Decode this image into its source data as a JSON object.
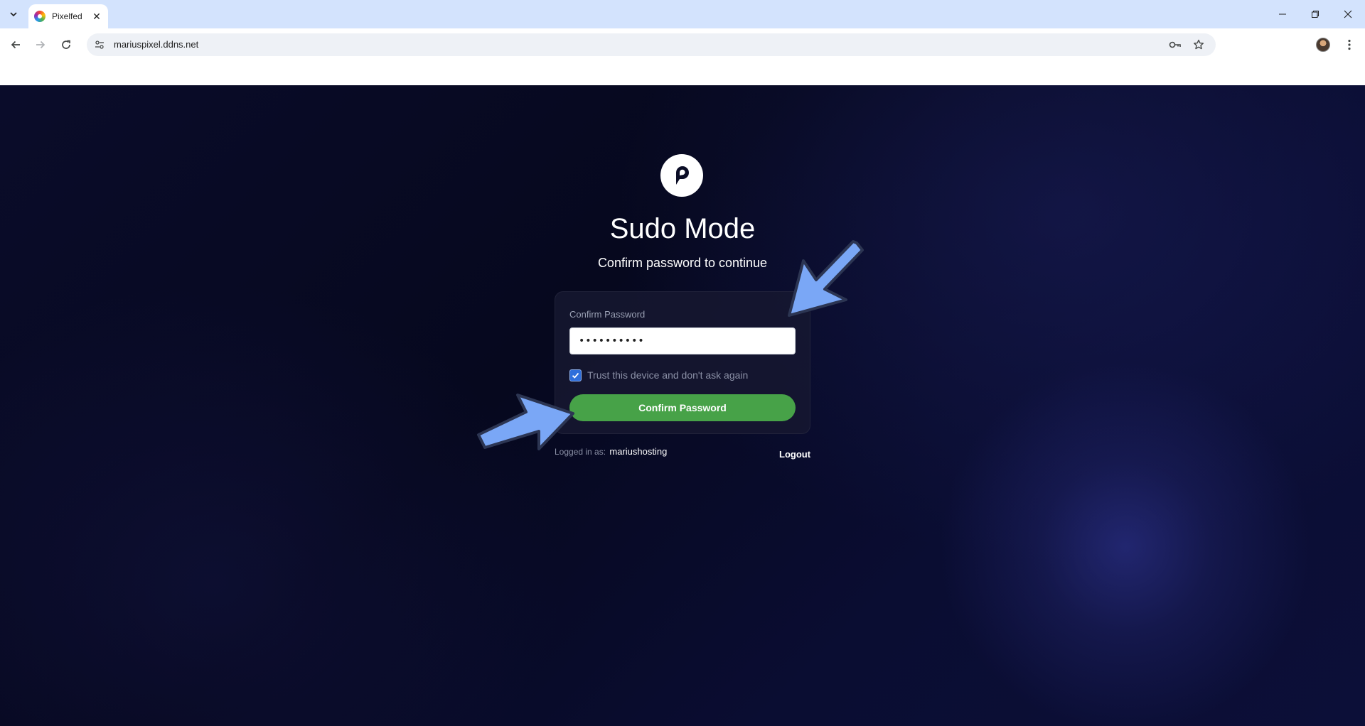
{
  "browser": {
    "tab_title": "Pixelfed",
    "url": "mariuspixel.ddns.net"
  },
  "page": {
    "title": "Sudo Mode",
    "subtitle": "Confirm password to continue",
    "form": {
      "password_label": "Confirm Password",
      "password_value": "••••••••••",
      "trust_checkbox_checked": true,
      "trust_label": "Trust this device and don't ask again",
      "submit_label": "Confirm Password"
    },
    "footer": {
      "logged_in_label": "Logged in as:",
      "username": "mariushosting",
      "logout_label": "Logout"
    }
  },
  "colors": {
    "accent_green": "#47a248",
    "checkbox_blue": "#2f6fdb",
    "annotation_arrow": "#7aa7f6",
    "background_navy": "#06081e"
  },
  "icons": [
    "tab-search-icon",
    "pixelfed-favicon",
    "close-icon",
    "minimize-icon",
    "restore-icon",
    "back-icon",
    "forward-icon",
    "reload-icon",
    "site-info-icon",
    "password-key-icon",
    "bookmark-star-icon",
    "profile-avatar",
    "more-menu-icon",
    "pixelfed-logo-icon",
    "checkmark-icon",
    "arrow-annotation-icon"
  ]
}
